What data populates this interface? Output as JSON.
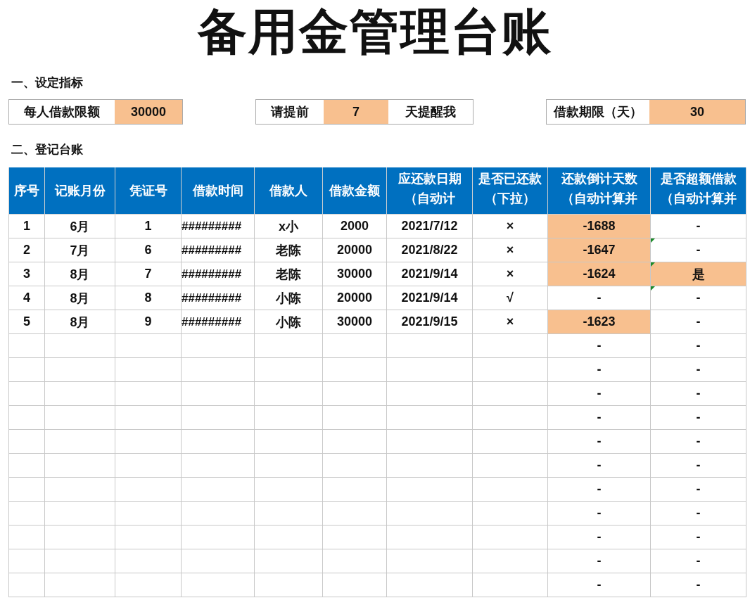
{
  "title": "备用金管理台账",
  "settings_heading": "一、设定指标",
  "settings": [
    {
      "cells": [
        {
          "text": "每人借款限额",
          "highlight": false
        },
        {
          "text": "30000",
          "highlight": true
        }
      ]
    },
    {
      "cells": [
        {
          "text": "请提前",
          "highlight": false
        },
        {
          "text": "7",
          "highlight": true
        },
        {
          "text": "天提醒我",
          "highlight": false
        }
      ]
    },
    {
      "cells": [
        {
          "text": "借款期限（天）",
          "highlight": false
        },
        {
          "text": "30",
          "highlight": true
        }
      ]
    }
  ],
  "ledger_heading": "二、登记台账",
  "table": {
    "columns": [
      "序号",
      "记账月份",
      "凭证号",
      "借款时间",
      "借款人",
      "借款金额",
      "应还款日期（自动计",
      "是否已还款（下拉）",
      "还款倒计天数（自动计算并",
      "是否超额借款（自动计算并"
    ],
    "rows": [
      {
        "cells": [
          "1",
          "6月",
          "1",
          "#########",
          "x小",
          "2000",
          "2021/7/12",
          "×"
        ],
        "countdown": {
          "text": "-1688",
          "highlight": true
        },
        "excess": {
          "text": "-",
          "highlight": false,
          "marker": false
        }
      },
      {
        "cells": [
          "2",
          "7月",
          "6",
          "#########",
          "老陈",
          "20000",
          "2021/8/22",
          "×"
        ],
        "countdown": {
          "text": "-1647",
          "highlight": true
        },
        "excess": {
          "text": "-",
          "highlight": false,
          "marker": true
        }
      },
      {
        "cells": [
          "3",
          "8月",
          "7",
          "#########",
          "老陈",
          "30000",
          "2021/9/14",
          "×"
        ],
        "countdown": {
          "text": "-1624",
          "highlight": true
        },
        "excess": {
          "text": "是",
          "highlight": true,
          "marker": true
        }
      },
      {
        "cells": [
          "4",
          "8月",
          "8",
          "#########",
          "小陈",
          "20000",
          "2021/9/14",
          "√"
        ],
        "countdown": {
          "text": "-",
          "highlight": false
        },
        "excess": {
          "text": "-",
          "highlight": false,
          "marker": true
        }
      },
      {
        "cells": [
          "5",
          "8月",
          "9",
          "#########",
          "小陈",
          "30000",
          "2021/9/15",
          "×"
        ],
        "countdown": {
          "text": "-1623",
          "highlight": true
        },
        "excess": {
          "text": "-",
          "highlight": false,
          "marker": false
        }
      },
      {
        "cells": [
          "",
          "",
          "",
          "",
          "",
          "",
          "",
          ""
        ],
        "countdown": {
          "text": "-",
          "highlight": false
        },
        "excess": {
          "text": "-",
          "highlight": false,
          "marker": false
        }
      },
      {
        "cells": [
          "",
          "",
          "",
          "",
          "",
          "",
          "",
          ""
        ],
        "countdown": {
          "text": "-",
          "highlight": false
        },
        "excess": {
          "text": "-",
          "highlight": false,
          "marker": false
        }
      },
      {
        "cells": [
          "",
          "",
          "",
          "",
          "",
          "",
          "",
          ""
        ],
        "countdown": {
          "text": "-",
          "highlight": false
        },
        "excess": {
          "text": "-",
          "highlight": false,
          "marker": false
        }
      },
      {
        "cells": [
          "",
          "",
          "",
          "",
          "",
          "",
          "",
          ""
        ],
        "countdown": {
          "text": "-",
          "highlight": false
        },
        "excess": {
          "text": "-",
          "highlight": false,
          "marker": false
        }
      },
      {
        "cells": [
          "",
          "",
          "",
          "",
          "",
          "",
          "",
          ""
        ],
        "countdown": {
          "text": "-",
          "highlight": false
        },
        "excess": {
          "text": "-",
          "highlight": false,
          "marker": false
        }
      },
      {
        "cells": [
          "",
          "",
          "",
          "",
          "",
          "",
          "",
          ""
        ],
        "countdown": {
          "text": "-",
          "highlight": false
        },
        "excess": {
          "text": "-",
          "highlight": false,
          "marker": false
        }
      },
      {
        "cells": [
          "",
          "",
          "",
          "",
          "",
          "",
          "",
          ""
        ],
        "countdown": {
          "text": "-",
          "highlight": false
        },
        "excess": {
          "text": "-",
          "highlight": false,
          "marker": false
        }
      },
      {
        "cells": [
          "",
          "",
          "",
          "",
          "",
          "",
          "",
          ""
        ],
        "countdown": {
          "text": "-",
          "highlight": false
        },
        "excess": {
          "text": "-",
          "highlight": false,
          "marker": false
        }
      },
      {
        "cells": [
          "",
          "",
          "",
          "",
          "",
          "",
          "",
          ""
        ],
        "countdown": {
          "text": "-",
          "highlight": false
        },
        "excess": {
          "text": "-",
          "highlight": false,
          "marker": false
        }
      },
      {
        "cells": [
          "",
          "",
          "",
          "",
          "",
          "",
          "",
          ""
        ],
        "countdown": {
          "text": "-",
          "highlight": false
        },
        "excess": {
          "text": "-",
          "highlight": false,
          "marker": false
        }
      },
      {
        "cells": [
          "",
          "",
          "",
          "",
          "",
          "",
          "",
          ""
        ],
        "countdown": {
          "text": "-",
          "highlight": false
        },
        "excess": {
          "text": "-",
          "highlight": false,
          "marker": false
        }
      }
    ]
  }
}
